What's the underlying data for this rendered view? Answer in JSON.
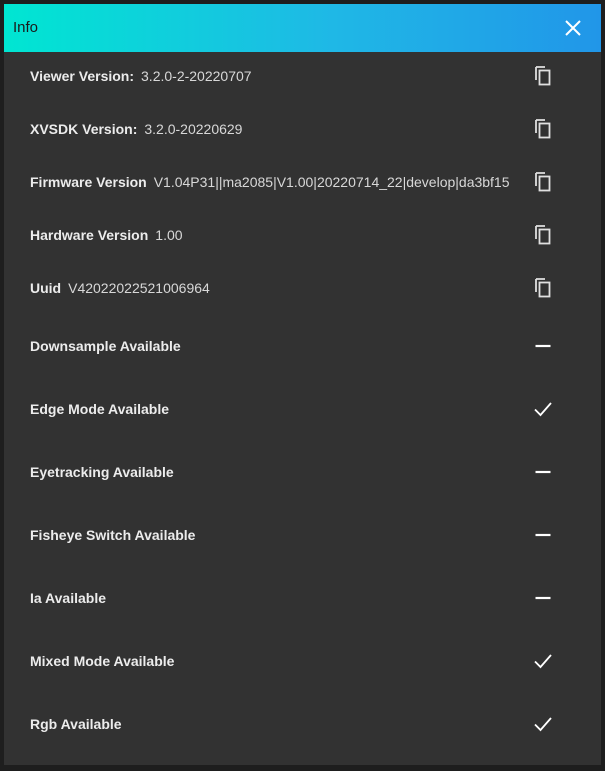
{
  "window": {
    "title": "Info"
  },
  "version_rows": [
    {
      "label": "Viewer Version:",
      "value": "3.2.0-2-20220707",
      "icon": "copy-icon"
    },
    {
      "label": "XVSDK Version:",
      "value": "3.2.0-20220629",
      "icon": "copy-icon"
    },
    {
      "label": "Firmware Version",
      "value": "V1.04P31||ma2085|V1.00|20220714_22|develop|da3bf15",
      "icon": "copy-icon"
    },
    {
      "label": "Hardware Version",
      "value": "1.00",
      "icon": "copy-icon"
    },
    {
      "label": "Uuid",
      "value": "V42022022521006964",
      "icon": "copy-icon"
    }
  ],
  "feature_rows": [
    {
      "label": "Downsample Available",
      "status": "unavailable",
      "icon": "dash-icon"
    },
    {
      "label": "Edge Mode Available",
      "status": "available",
      "icon": "check-icon"
    },
    {
      "label": "Eyetracking Available",
      "status": "unavailable",
      "icon": "dash-icon"
    },
    {
      "label": "Fisheye Switch Available",
      "status": "unavailable",
      "icon": "dash-icon"
    },
    {
      "label": "Ia Available",
      "status": "unavailable",
      "icon": "dash-icon"
    },
    {
      "label": "Mixed Mode Available",
      "status": "available",
      "icon": "check-icon"
    },
    {
      "label": "Rgb Available",
      "status": "available",
      "icon": "check-icon"
    }
  ],
  "colors": {
    "title_gradient_start": "#00e6d2",
    "title_gradient_end": "#2196e8",
    "dialog_background": "#323232",
    "text": "#ececec"
  }
}
